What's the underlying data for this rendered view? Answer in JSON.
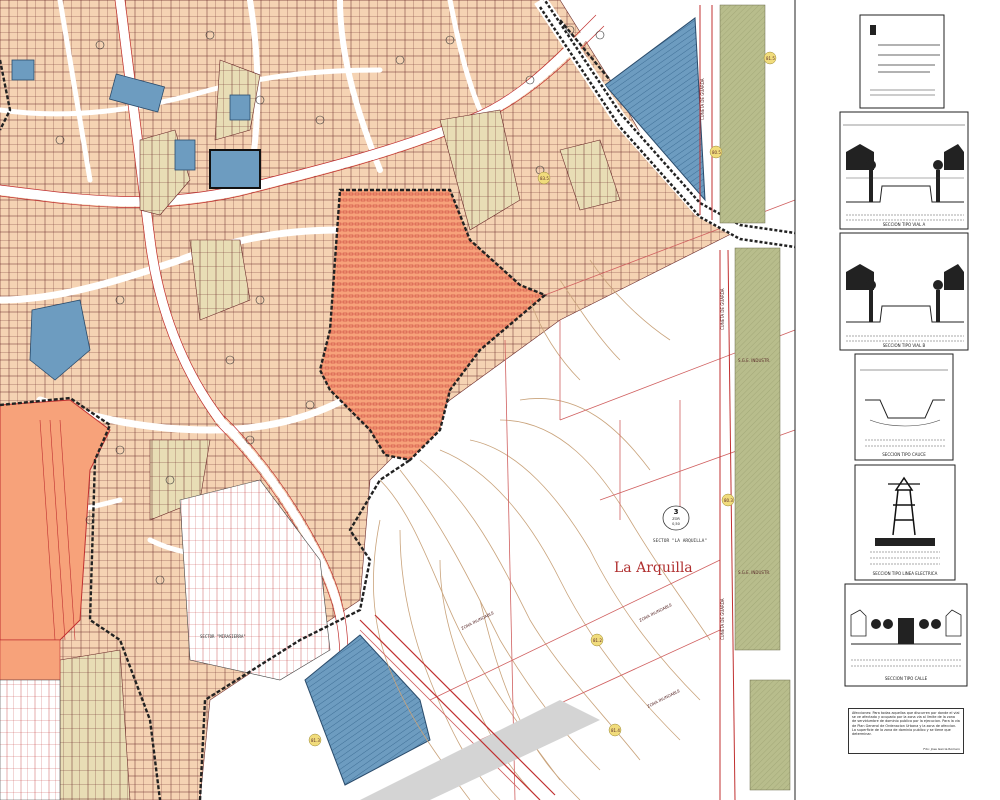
{
  "map": {
    "place_name": "La Arquilla",
    "sector_label": "SECTOR \"LA ARQUILLA\"",
    "sector_badge": {
      "number": "3",
      "line1": "ZOR",
      "line2": "0,50"
    },
    "sector2_label": "SECTOR \"MIRASIERRA\"",
    "road_labels": [
      "ZONA INUNDABLE",
      "ZONA INUNDABLE",
      "ZONA INUNDABLE"
    ],
    "road_label_vertical": [
      "CUNETA DE GUARDA",
      "CUNETA DE GUARDA",
      "CUNETA DE GUARDA"
    ],
    "green_strip_labels": [
      "S.G.E. INDUSTR.",
      "S.G.E. INDUSTR."
    ],
    "spot_codes": [
      "81.5",
      "80.5",
      "80.3",
      "81.2",
      "81.3",
      "81.4",
      "83.5"
    ],
    "colors": {
      "urban_fill": "#f5d3b3",
      "urban_green": "#e8ddb5",
      "green_zone": "#c7c9a0",
      "orange_sector": "#f7a27a",
      "blue_zone": "#6d9cc0",
      "red_line": "#c03030",
      "border_black": "#222222",
      "contour": "#c9a37b",
      "strip_green": "#b8bd8c"
    }
  },
  "legend_panels": [
    {
      "name": "panel-1",
      "caption": ""
    },
    {
      "name": "panel-2",
      "caption": "SECCION TIPO VIAL A"
    },
    {
      "name": "panel-3",
      "caption": "SECCION TIPO VIAL B"
    },
    {
      "name": "panel-4",
      "caption": "SECCION TIPO CAUCE"
    },
    {
      "name": "panel-5",
      "caption": "SECCION TIPO LINEA ELECTRICA"
    },
    {
      "name": "panel-6",
      "caption": "SECCION TIPO CALLE"
    }
  ],
  "note": {
    "text": "Afecciones: Para todas aquellas que discurren por donde el vial se ve afectado y ocupado por la zona via al limite de la zona de servidumbre de dominio publico por la ejecucion. Para la via de Plan General de Ordenacion Urbana y la zona de afeccion. La superficie de la zona de dominio publico y se tiene que determinar.",
    "signature": "Fdo: Jose Garcia Romero"
  }
}
